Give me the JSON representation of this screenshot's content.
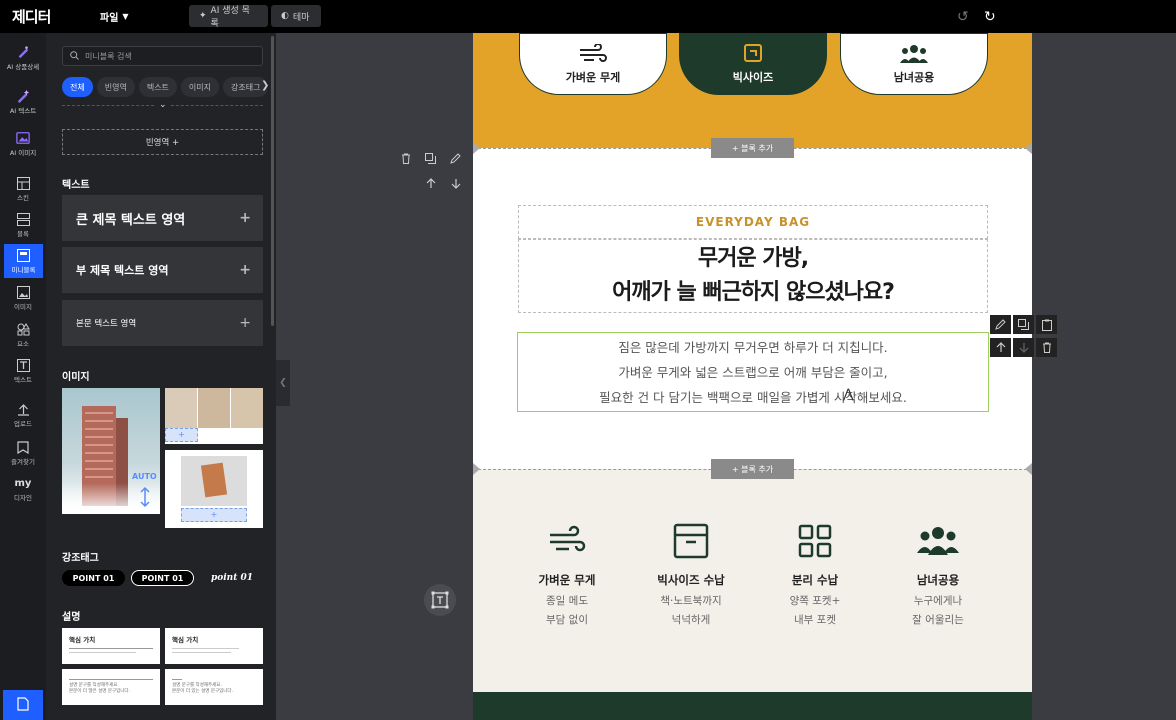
{
  "topbar": {
    "logo": "제디터",
    "file_menu": "파일",
    "ai_list_button": "AI 생성 목록",
    "theme_button": "테마"
  },
  "iconbar": {
    "items": [
      {
        "label": "AI 상품상세"
      },
      {
        "label": "AI 텍스트"
      },
      {
        "label": "AI 이미지"
      },
      {
        "label": "스킨"
      },
      {
        "label": "블록"
      },
      {
        "label": "미니블록"
      },
      {
        "label": "이미지"
      },
      {
        "label": "요소"
      },
      {
        "label": "텍스트"
      },
      {
        "label": "업로드"
      },
      {
        "label": "즐겨찾기"
      },
      {
        "label": "디자인"
      }
    ],
    "design_badge": "my"
  },
  "panel": {
    "search_placeholder": "미니블록 검색",
    "tabs": [
      "전체",
      "빈영역",
      "텍스트",
      "이미지",
      "강조태그"
    ],
    "blank_area_button": "빈영역 +",
    "text_section": "텍스트",
    "text_items": [
      "큰 제목 텍스트 영역",
      "부 제목 텍스트 영역",
      "본문 텍스트 영역"
    ],
    "image_section": "이미지",
    "image_auto_label": "AUTO",
    "emphasis_section": "강조태그",
    "pills": [
      "POINT 01",
      "POINT 01",
      "point 01"
    ],
    "desc_section": "설명",
    "desc_cards": [
      {
        "title": "핵심 가치"
      },
      {
        "title": "핵심 가치"
      },
      {
        "line1": "설명 문구를 작성해주세요.",
        "line2": "본문이 더 많은 설명 문구입니다."
      },
      {
        "line1": "설명 문구를 작성해주세요.",
        "line2": "본문이 더 있는 설명 문구입니다."
      }
    ]
  },
  "canvas": {
    "top_features": [
      "가벼운 무게",
      "빅사이즈",
      "남녀공용"
    ],
    "add_block_label": "+ 블록 추가",
    "eyebrow": "EVERYDAY BAG",
    "headline_line1": "무거운 가방,",
    "headline_line2": "어깨가 늘 뻐근하지 않으셨나요?",
    "body_line1": "짐은 많은데 가방까지 무거우면 하루가 더 지칩니다.",
    "body_line2": "가벼운 무게와 넓은 스트랩으로 어깨 부담은 줄이고,",
    "body_line3": "필요한 건 다 담기는 백팩으로 매일을 가볍게 시작해보세요.",
    "features": [
      {
        "title": "가벼운 무게",
        "line1": "종일 메도",
        "line2": "부담 없이"
      },
      {
        "title": "빅사이즈 수납",
        "line1": "책·노트북까지",
        "line2": "넉넉하게"
      },
      {
        "title": "분리 수납",
        "line1": "양쪽 포켓+",
        "line2": "내부 포켓"
      },
      {
        "title": "남녀공용",
        "line1": "누구에게나",
        "line2": "잘 어울리는"
      }
    ]
  },
  "colors": {
    "accent": "#1f5fff",
    "yellow": "#e3a328",
    "dark_green": "#1d3a2a",
    "cream": "#f3f0ea",
    "eyebrow": "#c9912a"
  }
}
